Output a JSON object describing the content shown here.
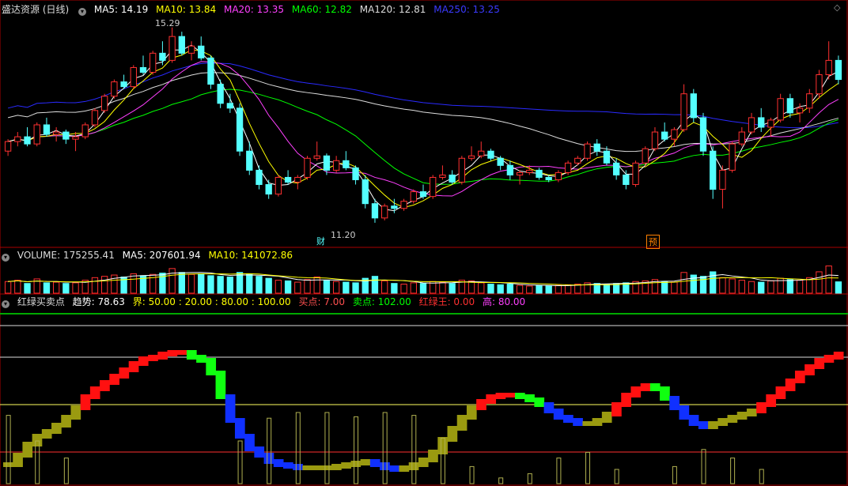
{
  "colors": {
    "up": "#ff3030",
    "down": "#54ffff",
    "ma5": "#ffffff",
    "ma10": "#ffff00",
    "ma20": "#ff40ff",
    "ma60": "#00ff00",
    "ma120": "#dddddd",
    "ma250": "#2a2aff",
    "hdr_title": "#dddddd",
    "hl": "#ffffff"
  },
  "price_header": {
    "title": "盛达资源 (日线)",
    "ma5": "MA5: 14.19",
    "ma10": "MA10: 13.84",
    "ma20": "MA20: 13.35",
    "ma60": "MA60: 12.82",
    "ma120": "MA120: 12.81",
    "ma250": "MA250: 13.25"
  },
  "price_annotations": {
    "high_label": "15.29",
    "low_label": "11.20",
    "fin_tag": "财",
    "pre_tag": "预"
  },
  "volume_header": {
    "title": "VOLUME: 175255.41",
    "ma5": "MA5: 207601.94",
    "ma10": "MA10: 141072.86"
  },
  "indicator_header": {
    "title": "红绿买卖点",
    "trend": "趋势: 78.63",
    "bound": "界: 50.00 : 20.00 : 80.00 : 100.00",
    "buy": "买点: 7.00",
    "sell": "卖点: 102.00",
    "red_king": "红绿王: 0.00",
    "high": "高: 80.00"
  },
  "chart_data": {
    "type": "candlestick",
    "price_range": [
      10.9,
      15.5
    ],
    "candles": [
      [
        12.7,
        12.95,
        12.6,
        12.9
      ],
      [
        12.9,
        13.1,
        12.8,
        13.0
      ],
      [
        13.0,
        13.2,
        12.8,
        12.85
      ],
      [
        12.85,
        13.3,
        12.8,
        13.25
      ],
      [
        13.25,
        13.4,
        13.0,
        13.05
      ],
      [
        13.05,
        13.2,
        12.9,
        13.1
      ],
      [
        13.1,
        13.15,
        12.85,
        12.95
      ],
      [
        12.95,
        13.1,
        12.7,
        13.0
      ],
      [
        13.0,
        13.3,
        12.95,
        13.25
      ],
      [
        13.25,
        13.6,
        13.2,
        13.55
      ],
      [
        13.55,
        13.9,
        13.5,
        13.85
      ],
      [
        13.85,
        14.2,
        13.8,
        14.15
      ],
      [
        14.15,
        14.3,
        14.0,
        14.05
      ],
      [
        14.05,
        14.5,
        14.0,
        14.45
      ],
      [
        14.45,
        14.7,
        14.3,
        14.35
      ],
      [
        14.35,
        14.8,
        14.3,
        14.75
      ],
      [
        14.75,
        15.0,
        14.5,
        14.6
      ],
      [
        14.6,
        15.29,
        14.55,
        15.1
      ],
      [
        15.1,
        15.2,
        14.7,
        14.75
      ],
      [
        14.75,
        15.0,
        14.6,
        14.9
      ],
      [
        14.9,
        15.1,
        14.6,
        14.65
      ],
      [
        14.65,
        14.7,
        14.0,
        14.1
      ],
      [
        14.1,
        14.2,
        13.6,
        13.7
      ],
      [
        13.7,
        13.9,
        13.5,
        13.6
      ],
      [
        13.6,
        13.7,
        12.6,
        12.7
      ],
      [
        12.7,
        12.9,
        12.2,
        12.3
      ],
      [
        12.3,
        12.4,
        11.9,
        12.0
      ],
      [
        12.0,
        12.1,
        11.7,
        11.8
      ],
      [
        11.8,
        12.2,
        11.75,
        12.15
      ],
      [
        12.15,
        12.3,
        12.0,
        12.05
      ],
      [
        12.05,
        12.2,
        11.9,
        12.15
      ],
      [
        12.15,
        12.6,
        12.1,
        12.55
      ],
      [
        12.55,
        12.9,
        12.5,
        12.6
      ],
      [
        12.6,
        12.65,
        12.2,
        12.3
      ],
      [
        12.3,
        12.6,
        12.25,
        12.5
      ],
      [
        12.5,
        12.7,
        12.3,
        12.35
      ],
      [
        12.35,
        12.4,
        12.0,
        12.1
      ],
      [
        12.1,
        12.2,
        11.5,
        11.6
      ],
      [
        11.6,
        11.7,
        11.2,
        11.3
      ],
      [
        11.3,
        11.6,
        11.25,
        11.55
      ],
      [
        11.55,
        11.7,
        11.4,
        11.5
      ],
      [
        11.5,
        11.7,
        11.45,
        11.65
      ],
      [
        11.65,
        11.9,
        11.6,
        11.85
      ],
      [
        11.85,
        12.0,
        11.7,
        11.75
      ],
      [
        11.75,
        12.2,
        11.7,
        12.15
      ],
      [
        12.15,
        12.4,
        12.1,
        12.2
      ],
      [
        12.2,
        12.3,
        12.0,
        12.05
      ],
      [
        12.05,
        12.6,
        12.0,
        12.55
      ],
      [
        12.55,
        12.8,
        12.5,
        12.6
      ],
      [
        12.6,
        12.9,
        12.55,
        12.7
      ],
      [
        12.7,
        12.75,
        12.5,
        12.55
      ],
      [
        12.55,
        12.6,
        12.3,
        12.4
      ],
      [
        12.4,
        12.5,
        12.1,
        12.2
      ],
      [
        12.2,
        12.3,
        12.0,
        12.25
      ],
      [
        12.25,
        12.4,
        12.2,
        12.3
      ],
      [
        12.3,
        12.35,
        12.1,
        12.15
      ],
      [
        12.15,
        12.2,
        12.05,
        12.1
      ],
      [
        12.1,
        12.3,
        12.05,
        12.25
      ],
      [
        12.25,
        12.5,
        12.2,
        12.45
      ],
      [
        12.45,
        12.6,
        12.4,
        12.55
      ],
      [
        12.55,
        12.9,
        12.5,
        12.85
      ],
      [
        12.85,
        12.95,
        12.6,
        12.7
      ],
      [
        12.7,
        12.8,
        12.4,
        12.45
      ],
      [
        12.45,
        12.55,
        12.1,
        12.2
      ],
      [
        12.2,
        12.3,
        11.9,
        12.0
      ],
      [
        12.0,
        12.5,
        11.95,
        12.45
      ],
      [
        12.45,
        12.8,
        12.4,
        12.75
      ],
      [
        12.75,
        13.2,
        12.7,
        13.1
      ],
      [
        13.1,
        13.3,
        12.9,
        12.95
      ],
      [
        12.95,
        13.2,
        12.8,
        13.15
      ],
      [
        13.15,
        14.1,
        13.1,
        13.9
      ],
      [
        13.9,
        14.0,
        13.3,
        13.4
      ],
      [
        13.4,
        13.5,
        12.6,
        12.7
      ],
      [
        12.7,
        12.8,
        11.7,
        11.9
      ],
      [
        11.9,
        12.4,
        11.5,
        12.3
      ],
      [
        12.3,
        12.9,
        12.25,
        12.85
      ],
      [
        12.85,
        13.2,
        12.8,
        13.1
      ],
      [
        13.1,
        13.5,
        13.05,
        13.4
      ],
      [
        13.4,
        13.6,
        13.1,
        13.2
      ],
      [
        13.2,
        13.4,
        13.0,
        13.35
      ],
      [
        13.35,
        13.9,
        13.3,
        13.8
      ],
      [
        13.8,
        13.9,
        13.4,
        13.5
      ],
      [
        13.5,
        13.7,
        13.3,
        13.6
      ],
      [
        13.6,
        14.0,
        13.5,
        13.9
      ],
      [
        13.9,
        14.4,
        13.8,
        14.3
      ],
      [
        14.3,
        15.0,
        14.2,
        14.6
      ],
      [
        14.6,
        14.7,
        14.1,
        14.2
      ]
    ],
    "volume_range": [
      0,
      500000
    ],
    "volume": [
      180000,
      200000,
      150000,
      220000,
      160000,
      170000,
      150000,
      160000,
      200000,
      240000,
      260000,
      280000,
      250000,
      300000,
      270000,
      290000,
      310000,
      380000,
      320000,
      290000,
      300000,
      270000,
      260000,
      250000,
      320000,
      300000,
      260000,
      230000,
      200000,
      190000,
      170000,
      210000,
      250000,
      200000,
      180000,
      170000,
      160000,
      230000,
      260000,
      190000,
      150000,
      140000,
      160000,
      150000,
      180000,
      170000,
      150000,
      200000,
      190000,
      160000,
      140000,
      130000,
      140000,
      120000,
      110000,
      120000,
      110000,
      120000,
      130000,
      140000,
      160000,
      150000,
      140000,
      150000,
      160000,
      180000,
      190000,
      210000,
      180000,
      170000,
      320000,
      280000,
      260000,
      330000,
      240000,
      220000,
      200000,
      180000,
      170000,
      190000,
      230000,
      210000,
      200000,
      240000,
      330000,
      420000,
      175255
    ],
    "indicator_range": [
      0,
      110
    ],
    "indicator_levels": [
      20,
      50,
      80,
      100
    ],
    "indicator": [
      12,
      18,
      25,
      30,
      33,
      37,
      42,
      48,
      55,
      60,
      64,
      68,
      72,
      76,
      79,
      80,
      82,
      83,
      83,
      80,
      78,
      70,
      55,
      40,
      30,
      22,
      18,
      14,
      12,
      11,
      10,
      10,
      10,
      10,
      11,
      12,
      13,
      14,
      12,
      10,
      9,
      10,
      12,
      15,
      20,
      28,
      35,
      42,
      48,
      52,
      55,
      56,
      56,
      55,
      53,
      50,
      46,
      42,
      40,
      38,
      38,
      40,
      44,
      50,
      56,
      60,
      62,
      60,
      54,
      48,
      42,
      38,
      36,
      38,
      40,
      42,
      44,
      46,
      50,
      55,
      60,
      65,
      70,
      74,
      78,
      80,
      82
    ]
  }
}
